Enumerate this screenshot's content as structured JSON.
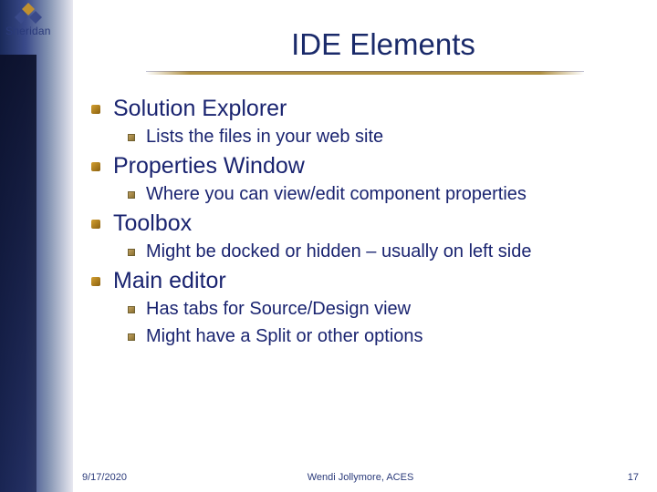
{
  "logo_text": "Sheridan",
  "title": "IDE Elements",
  "bullets": [
    {
      "text": "Solution Explorer",
      "subs": [
        "Lists the files in your web site"
      ]
    },
    {
      "text": "Properties Window",
      "subs": [
        "Where you can view/edit component properties"
      ]
    },
    {
      "text": "Toolbox",
      "subs": [
        "Might be docked or hidden – usually on left side"
      ]
    },
    {
      "text": "Main editor",
      "subs": [
        "Has tabs for Source/Design view",
        "Might have a Split or other options"
      ]
    }
  ],
  "footer": {
    "date": "9/17/2020",
    "author": "Wendi Jollymore, ACES",
    "page": "17"
  }
}
